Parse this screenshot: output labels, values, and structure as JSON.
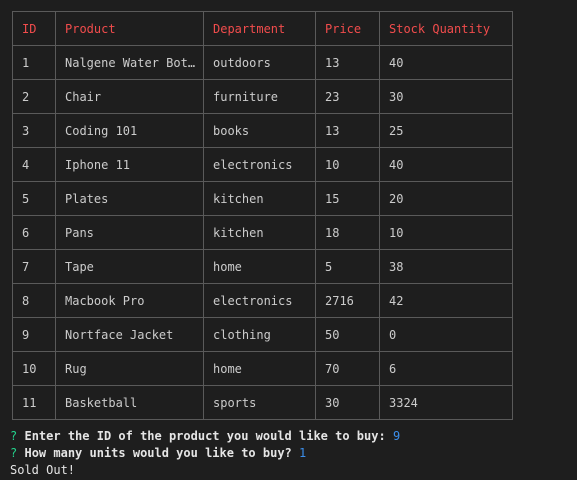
{
  "table": {
    "columns": [
      "ID",
      "Product",
      "Department",
      "Price",
      "Stock Quantity"
    ],
    "rows": [
      [
        "1",
        "Nalgene Water Bot…",
        "outdoors",
        "13",
        "40"
      ],
      [
        "2",
        "Chair",
        "furniture",
        "23",
        "30"
      ],
      [
        "3",
        "Coding 101",
        "books",
        "13",
        "25"
      ],
      [
        "4",
        "Iphone 11",
        "electronics",
        "10",
        "40"
      ],
      [
        "5",
        "Plates",
        "kitchen",
        "15",
        "20"
      ],
      [
        "6",
        "Pans",
        "kitchen",
        "18",
        "10"
      ],
      [
        "7",
        "Tape",
        "home",
        "5",
        "38"
      ],
      [
        "8",
        "Macbook Pro",
        "electronics",
        "2716",
        "42"
      ],
      [
        "9",
        "Nortface Jacket",
        "clothing",
        "50",
        "0"
      ],
      [
        "10",
        "Rug",
        "home",
        "70",
        "6"
      ],
      [
        "11",
        "Basketball",
        "sports",
        "30",
        "3324"
      ]
    ]
  },
  "console": {
    "prompt1": {
      "mark": "?",
      "question": "Enter the ID of the product you would like to buy:",
      "answer": "9"
    },
    "prompt2": {
      "mark": "?",
      "question": "How many units would you like to buy?",
      "answer": "1"
    },
    "result": "Sold Out!"
  },
  "colors": {
    "background": "#1e1e1e",
    "header_text": "#f14c4c",
    "cell_text": "#cccccc",
    "border": "#5a5a5a",
    "prompt_mark": "#23d18b",
    "answer": "#3b8eea"
  }
}
